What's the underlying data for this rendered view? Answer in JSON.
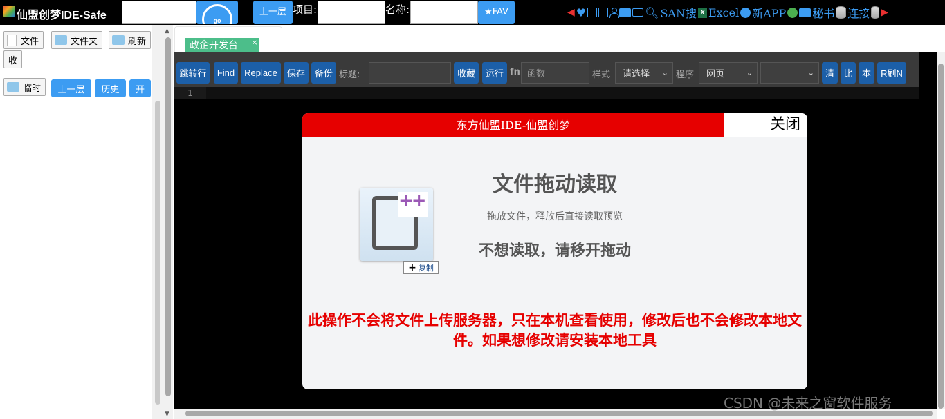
{
  "topbar": {
    "app_title": "仙盟创梦IDE-Safe",
    "go_label": "go",
    "up_label": "上一层",
    "project_label": "项目:",
    "name_label": "名称:",
    "fav_label": "★FAV",
    "icons": {
      "san_label": "SAN搜",
      "excel_label": "Excel",
      "new_app_label": "新APP",
      "secretary_label": "秘书",
      "connect_label": "连接"
    }
  },
  "sidebar": {
    "file_label": "文件",
    "folder_label": "文件夹",
    "refresh_label": "刷新",
    "collapse_label": "收",
    "temp_label": "临时",
    "up_label": "上一层",
    "history_label": "历史",
    "open_label": "开"
  },
  "tab": {
    "label": "政企开发台",
    "close": "×"
  },
  "toolbar": {
    "goto_label": "跳转行",
    "find_label": "Find",
    "replace_label": "Replace",
    "save_label": "保存",
    "backup_label": "备份",
    "title_label": "标题:",
    "collect_label": "收藏",
    "run_label": "运行",
    "fn_label": "fn",
    "func_placeholder": "函数",
    "style_label": "样式",
    "style_value": "请选择",
    "program_label": "程序",
    "program_value": "网页",
    "clear_label": "清",
    "compare_label": "比",
    "local_label": "本",
    "refresh_label": "R刷N"
  },
  "editor": {
    "line_number": "1"
  },
  "modal": {
    "header": "东方仙盟IDE-仙盟创梦",
    "close_label": "关闭",
    "title": "文件拖动读取",
    "subtitle": "拖放文件，释放后直接读取预览",
    "warn": "不想读取，请移开拖动",
    "copy_label": "复制",
    "note": "此操作不会将文件上传服务器，只在本机查看使用，修改后也不会修改本地文件。如果想修改请安装本地工具"
  },
  "watermark": "CSDN @未来之窗软件服务"
}
